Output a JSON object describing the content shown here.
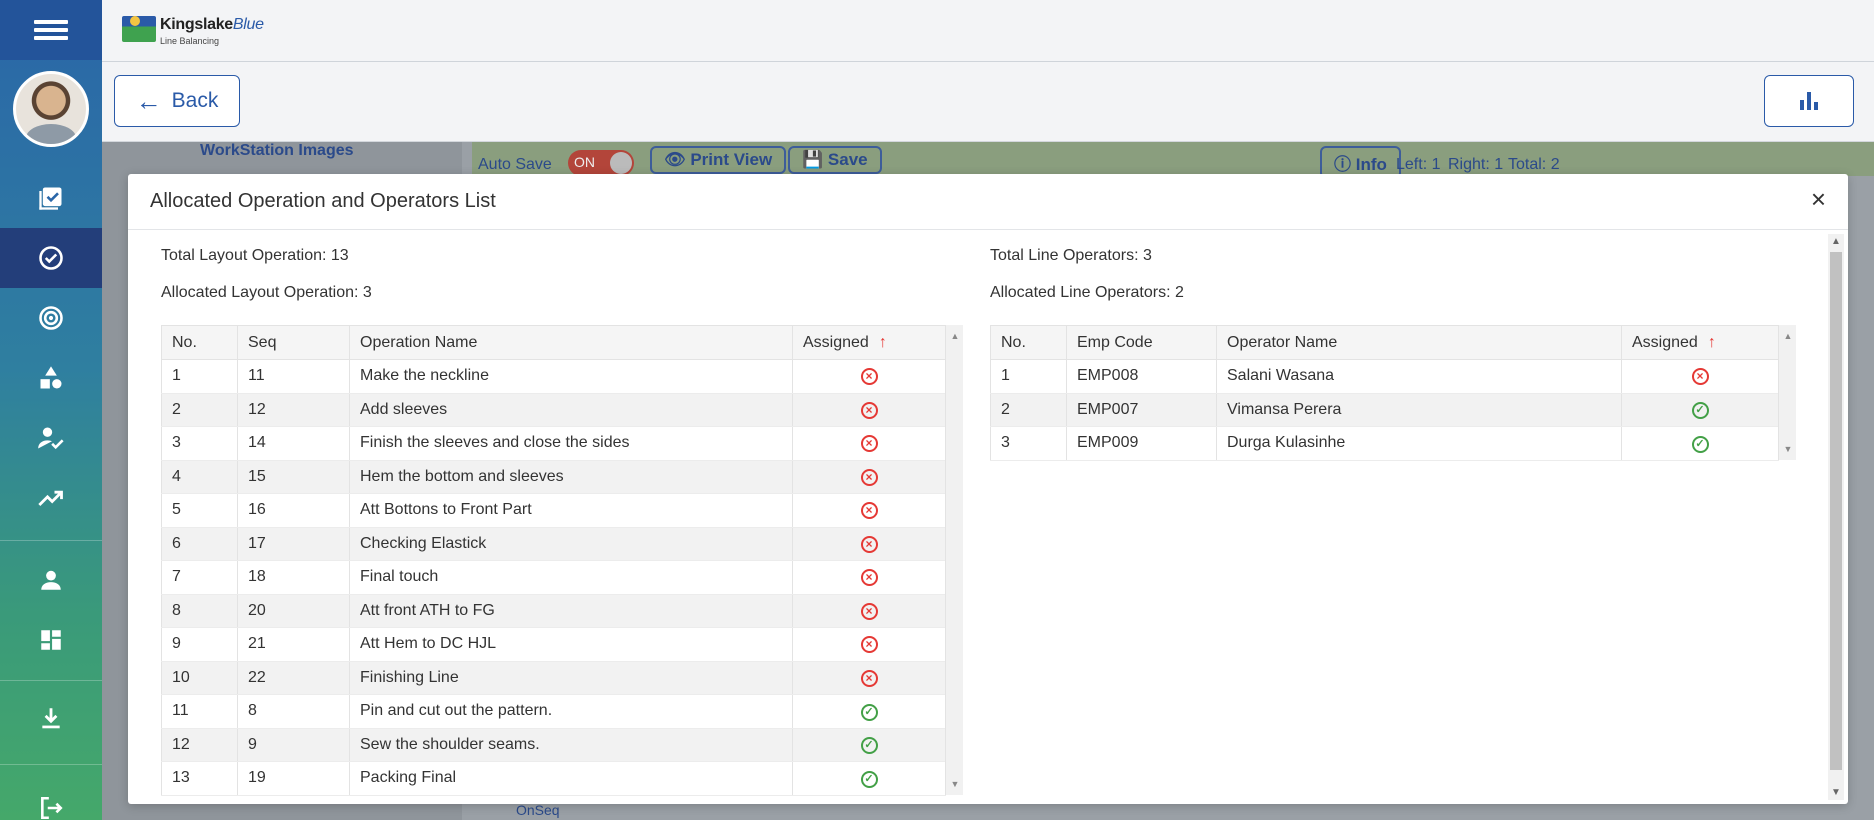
{
  "brand": {
    "name": "Kingslake",
    "name_accent": "Blue",
    "subtitle": "Line Balancing"
  },
  "nav": {
    "back_label": "Back"
  },
  "background": {
    "panel_title": "WorkStation Images",
    "auto_save": "Auto Save",
    "toggle": "ON",
    "print_view": "Print View",
    "save": "Save",
    "info": "Info",
    "left": "Left: 1",
    "right": "Right: 1",
    "total": "Total: 2",
    "onseq": "OnSeq"
  },
  "modal": {
    "title": "Allocated Operation and Operators List",
    "close": "×",
    "operations": {
      "total_label": "Total Layout Operation: 13",
      "allocated_label": "Allocated Layout Operation: 3",
      "columns": [
        "No.",
        "Seq",
        "Operation Name",
        "Assigned"
      ],
      "rows": [
        {
          "no": "1",
          "seq": "11",
          "name": "Make the neckline",
          "assigned": false
        },
        {
          "no": "2",
          "seq": "12",
          "name": "Add sleeves",
          "assigned": false
        },
        {
          "no": "3",
          "seq": "14",
          "name": "Finish the sleeves and close the sides",
          "assigned": false
        },
        {
          "no": "4",
          "seq": "15",
          "name": "Hem the bottom and sleeves",
          "assigned": false
        },
        {
          "no": "5",
          "seq": "16",
          "name": "Att Bottons to Front Part",
          "assigned": false
        },
        {
          "no": "6",
          "seq": "17",
          "name": "Checking Elastick",
          "assigned": false
        },
        {
          "no": "7",
          "seq": "18",
          "name": "Final touch",
          "assigned": false
        },
        {
          "no": "8",
          "seq": "20",
          "name": "Att front ATH to FG",
          "assigned": false
        },
        {
          "no": "9",
          "seq": "21",
          "name": "Att Hem to DC HJL",
          "assigned": false
        },
        {
          "no": "10",
          "seq": "22",
          "name": "Finishing Line",
          "assigned": false
        },
        {
          "no": "11",
          "seq": "8",
          "name": "Pin and cut out the pattern.",
          "assigned": true
        },
        {
          "no": "12",
          "seq": "9",
          "name": "Sew the shoulder seams.",
          "assigned": true
        },
        {
          "no": "13",
          "seq": "19",
          "name": "Packing Final",
          "assigned": true
        }
      ]
    },
    "operators": {
      "total_label": "Total Line Operators: 3",
      "allocated_label": "Allocated Line Operators: 2",
      "columns": [
        "No.",
        "Emp Code",
        "Operator Name",
        "Assigned"
      ],
      "rows": [
        {
          "no": "1",
          "code": "EMP008",
          "name": "Salani Wasana",
          "assigned": false
        },
        {
          "no": "2",
          "code": "EMP007",
          "name": "Vimansa Perera",
          "assigned": true
        },
        {
          "no": "3",
          "code": "EMP009",
          "name": "Durga Kulasinhe",
          "assigned": true
        }
      ]
    }
  },
  "colors": {
    "primary": "#2a5aa8",
    "sidebar_active": "#233e7a",
    "unassigned": "#e53935",
    "assigned": "#43a047",
    "sort_arrow": "#e53935"
  },
  "icons": {
    "sidebar": [
      "menu-icon",
      "checklist-icon",
      "check-circle-icon",
      "target-icon",
      "shapes-icon",
      "user-check-icon",
      "trending-up-icon",
      "person-icon",
      "dashboard-icon",
      "download-icon",
      "logout-icon"
    ]
  }
}
